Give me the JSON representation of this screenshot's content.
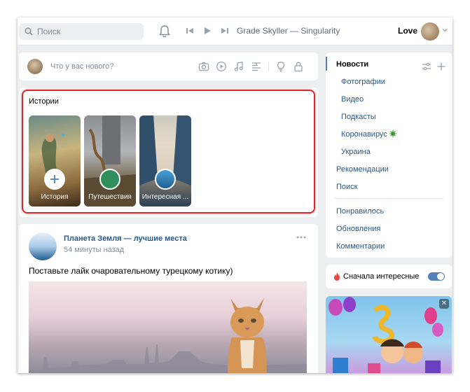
{
  "header": {
    "search_placeholder": "Поиск",
    "track": "Grade Skyller — Singularity",
    "user_name": "Love"
  },
  "composer": {
    "placeholder": "Что у вас нового?"
  },
  "stories": {
    "title": "Истории",
    "items": [
      {
        "label": "История"
      },
      {
        "label": "Путешествия"
      },
      {
        "label": "Интересная ..."
      }
    ]
  },
  "post": {
    "author": "Планета Земля — лучшие места",
    "time": "54 минуты назад",
    "text": "Поставьте лайк очаровательному турецкому котику)"
  },
  "nav": {
    "news": "Новости",
    "photos": "Фотографии",
    "video": "Видео",
    "podcasts": "Подкасты",
    "coronavirus": "Коронавирус",
    "ukraine": "Украина",
    "recommendations": "Рекомендации",
    "search": "Поиск",
    "liked": "Понравилось",
    "updates": "Обновления",
    "comments": "Комментарии"
  },
  "toggle": {
    "label": "Сначала интересные",
    "on": true
  },
  "ad": {
    "close": "✕"
  },
  "colors": {
    "link": "#2a5885",
    "accent": "#5181b8",
    "highlight": "#e0262f",
    "background": "#edeef0"
  },
  "icons": [
    "search-icon",
    "bell-icon",
    "prev-icon",
    "play-icon",
    "next-icon",
    "chevron-down-icon",
    "camera-icon",
    "video-icon",
    "music-icon",
    "article-icon",
    "idea-icon",
    "lock-icon",
    "plus-icon",
    "tune-icon",
    "virus-icon",
    "fire-icon",
    "close-icon",
    "more-icon"
  ]
}
